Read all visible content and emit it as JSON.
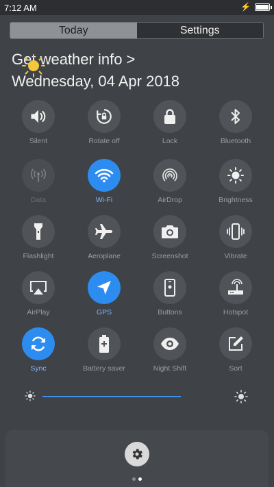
{
  "status_bar": {
    "time": "7:12 AM",
    "battery_level": 1.0
  },
  "tabs": [
    {
      "label": "Today",
      "active": true
    },
    {
      "label": "Settings",
      "active": false
    }
  ],
  "weather": {
    "title": "Get weather info >",
    "date": "Wednesday, 04 Apr 2018"
  },
  "tiles": [
    {
      "label": "Silent",
      "icon": "speaker-icon",
      "state": "off"
    },
    {
      "label": "Rotate off",
      "icon": "rotate-lock-icon",
      "state": "off"
    },
    {
      "label": "Lock",
      "icon": "lock-icon",
      "state": "off"
    },
    {
      "label": "Bluetooth",
      "icon": "bluetooth-icon",
      "state": "off"
    },
    {
      "label": "Data",
      "icon": "antenna-icon",
      "state": "disabled"
    },
    {
      "label": "Wi-Fi",
      "icon": "wifi-icon",
      "state": "on"
    },
    {
      "label": "AirDrop",
      "icon": "airdrop-icon",
      "state": "off"
    },
    {
      "label": "Brightness",
      "icon": "brightness-icon",
      "state": "off"
    },
    {
      "label": "Flashlight",
      "icon": "flashlight-icon",
      "state": "off"
    },
    {
      "label": "Aeroplane",
      "icon": "aeroplane-icon",
      "state": "off"
    },
    {
      "label": "Screenshot",
      "icon": "camera-icon",
      "state": "off"
    },
    {
      "label": "Vibrate",
      "icon": "vibrate-icon",
      "state": "off"
    },
    {
      "label": "AirPlay",
      "icon": "airplay-icon",
      "state": "off"
    },
    {
      "label": "GPS",
      "icon": "navigation-icon",
      "state": "on"
    },
    {
      "label": "Buttons",
      "icon": "phone-buttons-icon",
      "state": "off"
    },
    {
      "label": "Hotspot",
      "icon": "router-icon",
      "state": "off"
    },
    {
      "label": "Sync",
      "icon": "sync-icon",
      "state": "on"
    },
    {
      "label": "Battery saver",
      "icon": "battery-saver-icon",
      "state": "off"
    },
    {
      "label": "Night Shift",
      "icon": "eye-icon",
      "state": "off"
    },
    {
      "label": "Sort",
      "icon": "edit-icon",
      "state": "off"
    }
  ],
  "brightness": {
    "level": 0.66
  },
  "colors": {
    "accent": "#2d8cf0",
    "tile": "#505357",
    "background": "#3f4246"
  },
  "pager": {
    "pages": 2,
    "current": 1
  }
}
